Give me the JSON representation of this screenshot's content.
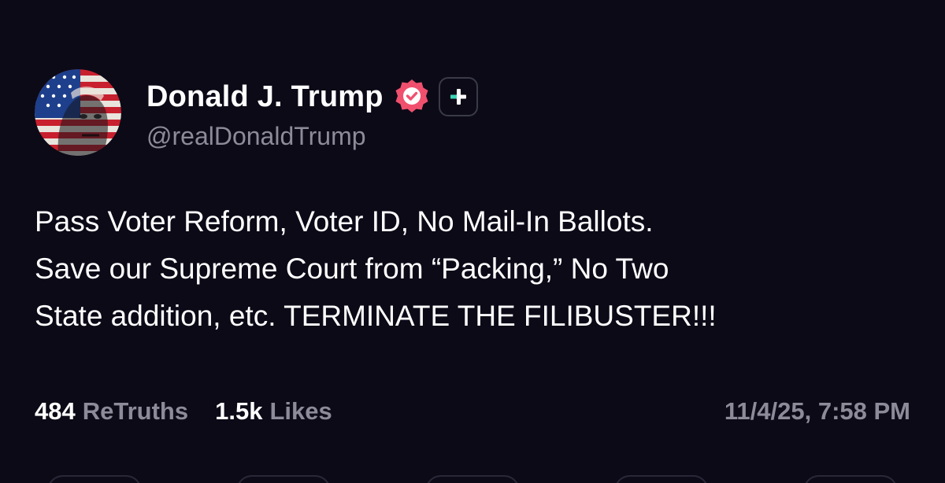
{
  "author": {
    "display_name": "Donald J. Trump",
    "handle": "@realDonaldTrump",
    "avatar_icon": "flag-portrait-avatar",
    "verified_icon": "verified-badge-icon",
    "plus_icon": "plus-badge-icon"
  },
  "post": {
    "lines": [
      "Pass Voter Reform, Voter ID, No Mail-In Ballots.",
      "Save our Supreme Court from “Packing,” No Two",
      "State addition, etc. TERMINATE THE FILIBUSTER!!!"
    ]
  },
  "stats": {
    "retruths_count": "484",
    "retruths_label": "ReTruths",
    "likes_count": "1.5k",
    "likes_label": "Likes"
  },
  "timestamp": "11/4/25, 7:58 PM",
  "colors": {
    "background": "#0c0a17",
    "verified": "#f0506e",
    "plus_accent": "#3ad6b4",
    "muted_text": "#8d8b99"
  }
}
